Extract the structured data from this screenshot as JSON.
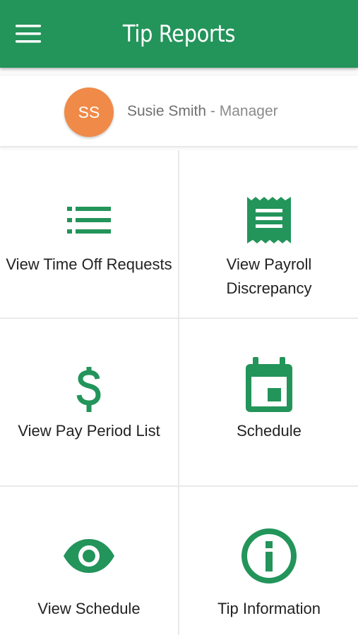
{
  "app_bar": {
    "title": "Tip Reports",
    "menu_icon": "hamburger-menu-icon",
    "color": "#23945a"
  },
  "profile": {
    "initials": "SS",
    "name": "Susie Smith",
    "separator": "-",
    "role": "Manager",
    "avatar_color": "#f08a48"
  },
  "tiles": [
    {
      "label": "View Time Off Requests",
      "icon": "list-icon"
    },
    {
      "label": "View Payroll Discrepancy",
      "icon": "receipt-icon"
    },
    {
      "label": "View Pay Period List",
      "icon": "dollar-icon"
    },
    {
      "label": "Schedule",
      "icon": "calendar-icon"
    },
    {
      "label": "View Schedule",
      "icon": "eye-icon"
    },
    {
      "label": "Tip Information",
      "icon": "info-icon"
    }
  ],
  "accent_color": "#23945a"
}
